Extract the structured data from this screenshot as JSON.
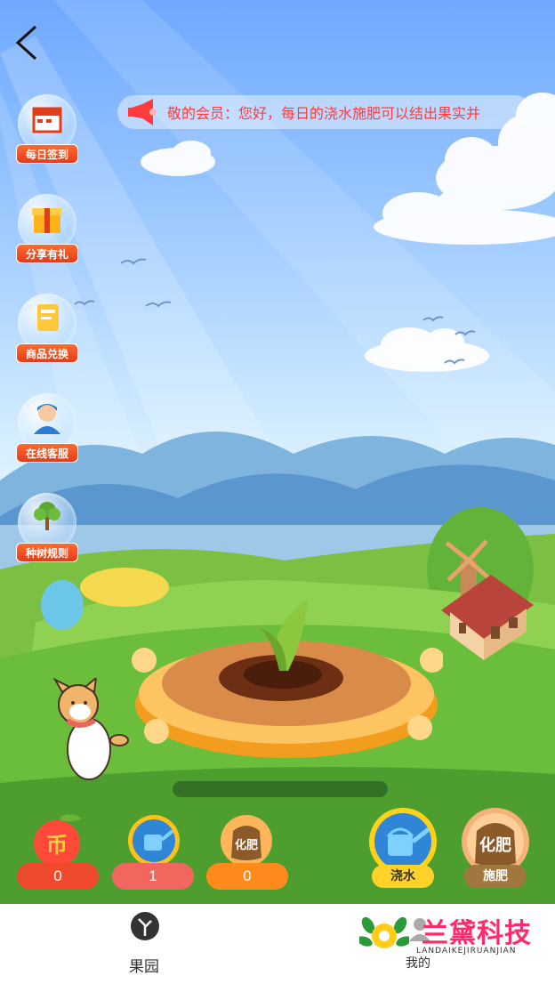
{
  "notice": {
    "text": "敬的会员：您好，每日的浇水施肥可以结出果实并"
  },
  "side_menu": [
    {
      "id": "checkin",
      "label": "每日签到",
      "icon": "calendar-icon"
    },
    {
      "id": "share",
      "label": "分享有礼",
      "icon": "gift-icon"
    },
    {
      "id": "exchange",
      "label": "商品兑换",
      "icon": "card-icon"
    },
    {
      "id": "service",
      "label": "在线客服",
      "icon": "agent-icon"
    },
    {
      "id": "rules",
      "label": "种树规则",
      "icon": "tree-icon"
    }
  ],
  "resources": {
    "coin": {
      "icon_text": "币",
      "value": "0"
    },
    "water": {
      "value": "1"
    },
    "fertilizer": {
      "icon_text": "化肥",
      "value": "0"
    }
  },
  "actions": {
    "water_label": "浇水",
    "fertilize_label": "施肥",
    "fertilize_icon_text": "化肥"
  },
  "tabbar": {
    "orchard": "果园",
    "mine": "我的"
  },
  "watermark": {
    "brand": "兰黛科技",
    "sub": "LANDAIKEJIRUANJIAN"
  },
  "colors": {
    "notice_text": "#ff3b3b",
    "side_label_bg": "#e23c1a",
    "coin_pill": "#f04a2e",
    "water_pill": "#f26660",
    "fert_pill": "#ff8a1c",
    "grass": "#5fae33"
  }
}
